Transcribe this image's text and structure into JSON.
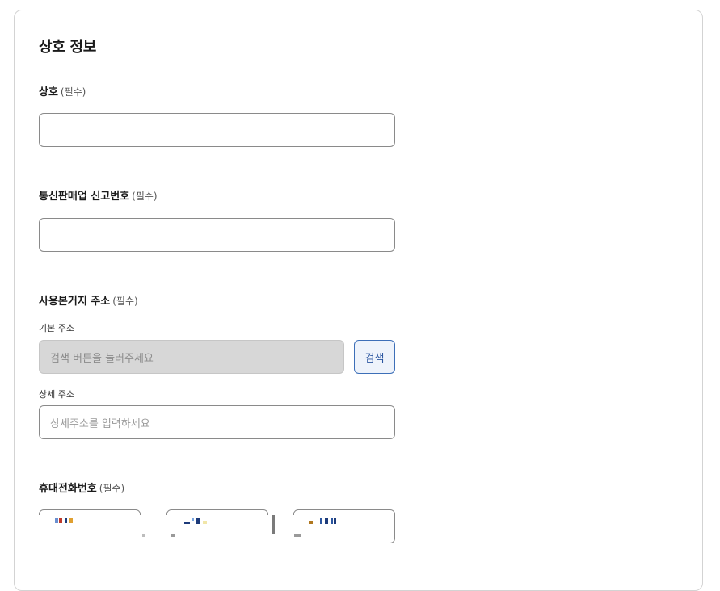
{
  "section": {
    "title": "상호 정보"
  },
  "fields": {
    "business_name": {
      "label": "상호",
      "required": "(필수)",
      "value": ""
    },
    "mail_order_number": {
      "label": "통신판매업 신고번호",
      "required": "(필수)",
      "value": ""
    },
    "address": {
      "label": "사용본거지 주소",
      "required": "(필수)",
      "basic_label": "기본 주소",
      "basic_placeholder": "검색 버튼을 눌러주세요",
      "search_button": "검색",
      "detail_label": "상세 주소",
      "detail_placeholder": "상세주소를 입력하세요"
    },
    "phone": {
      "label": "휴대전화번호",
      "required": "(필수)"
    }
  }
}
